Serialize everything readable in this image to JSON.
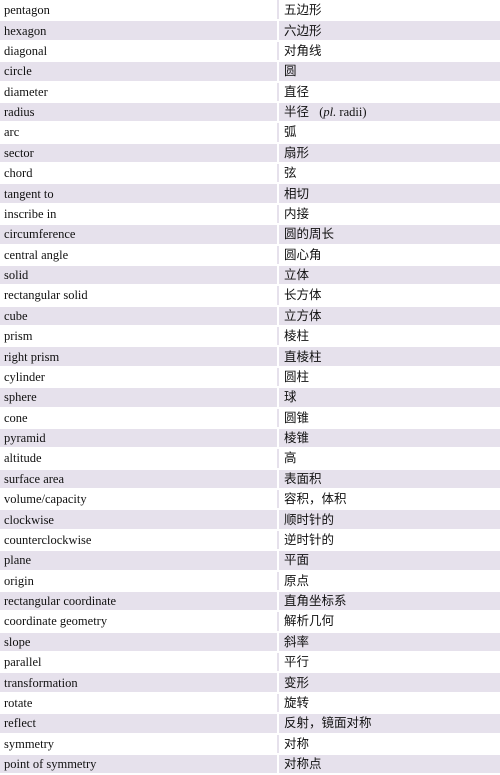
{
  "table": {
    "rows": [
      {
        "en": "pentagon",
        "zh": "五边形"
      },
      {
        "en": "hexagon",
        "zh": "六边形"
      },
      {
        "en": "diagonal",
        "zh": "对角线"
      },
      {
        "en": "circle",
        "zh": "圆"
      },
      {
        "en": "diameter",
        "zh": "直径"
      },
      {
        "en": "radius",
        "zh": "半径",
        "note_prefix": "(",
        "note_italic": "pl.",
        "note_rest": " radii)"
      },
      {
        "en": "arc",
        "zh": "弧"
      },
      {
        "en": "sector",
        "zh": "扇形"
      },
      {
        "en": "chord",
        "zh": "弦"
      },
      {
        "en": "tangent to",
        "zh": "相切"
      },
      {
        "en": "inscribe in",
        "zh": "内接"
      },
      {
        "en": "circumference",
        "zh": "圆的周长"
      },
      {
        "en": "central angle",
        "zh": "圆心角"
      },
      {
        "en": "solid",
        "zh": "立体"
      },
      {
        "en": "rectangular solid",
        "zh": "长方体"
      },
      {
        "en": "cube",
        "zh": "立方体"
      },
      {
        "en": "prism",
        "zh": "棱柱"
      },
      {
        "en": "right prism",
        "zh": "直棱柱"
      },
      {
        "en": "cylinder",
        "zh": "圆柱"
      },
      {
        "en": "sphere",
        "zh": "球"
      },
      {
        "en": "cone",
        "zh": "圆锥"
      },
      {
        "en": "pyramid",
        "zh": "棱锥"
      },
      {
        "en": "altitude",
        "zh": "高"
      },
      {
        "en": "surface area",
        "zh": "表面积"
      },
      {
        "en": "volume/capacity",
        "zh": "容积，体积"
      },
      {
        "en": "clockwise",
        "zh": "顺时针的"
      },
      {
        "en": "counterclockwise",
        "zh": "逆时针的"
      },
      {
        "en": "plane",
        "zh": "平面"
      },
      {
        "en": "origin",
        "zh": "原点"
      },
      {
        "en": "rectangular coordinate",
        "zh": "直角坐标系"
      },
      {
        "en": "coordinate geometry",
        "zh": "解析几何"
      },
      {
        "en": "slope",
        "zh": "斜率"
      },
      {
        "en": "parallel",
        "zh": "平行"
      },
      {
        "en": "transformation",
        "zh": "变形"
      },
      {
        "en": "rotate",
        "zh": "旋转"
      },
      {
        "en": "reflect",
        "zh": "反射，镜面对称"
      },
      {
        "en": "symmetry",
        "zh": "对称"
      },
      {
        "en": "point of symmetry",
        "zh": "对称点"
      }
    ]
  },
  "colors": {
    "row_alt_background": "#e6e1ec",
    "row_background": "#ffffff",
    "text": "#111111"
  }
}
